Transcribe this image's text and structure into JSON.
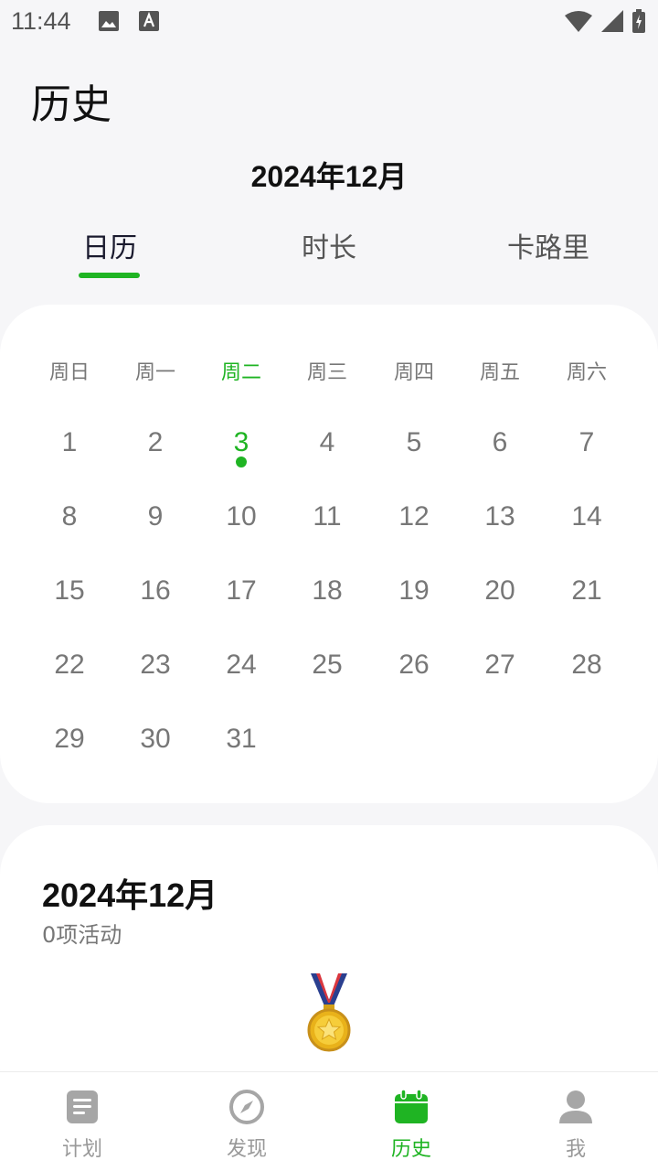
{
  "status_bar": {
    "time": "11:44"
  },
  "header": {
    "title": "历史",
    "month": "2024年12月"
  },
  "tabs": [
    {
      "label": "日历",
      "active": true
    },
    {
      "label": "时长",
      "active": false
    },
    {
      "label": "卡路里",
      "active": false
    }
  ],
  "calendar": {
    "weekdays": [
      "周日",
      "周一",
      "周二",
      "周三",
      "周四",
      "周五",
      "周六"
    ],
    "today_weekday_index": 2,
    "days": [
      [
        "1",
        "2",
        "3",
        "4",
        "5",
        "6",
        "7"
      ],
      [
        "8",
        "9",
        "10",
        "11",
        "12",
        "13",
        "14"
      ],
      [
        "15",
        "16",
        "17",
        "18",
        "19",
        "20",
        "21"
      ],
      [
        "22",
        "23",
        "24",
        "25",
        "26",
        "27",
        "28"
      ],
      [
        "29",
        "30",
        "31"
      ]
    ],
    "today": "3"
  },
  "summary": {
    "month": "2024年12月",
    "count": "0项活动"
  },
  "bottom_nav": [
    {
      "label": "计划",
      "icon": "plan-icon",
      "active": false
    },
    {
      "label": "发现",
      "icon": "compass-icon",
      "active": false
    },
    {
      "label": "历史",
      "icon": "calendar-icon",
      "active": true
    },
    {
      "label": "我",
      "icon": "person-icon",
      "active": false
    }
  ],
  "colors": {
    "accent": "#1fb423",
    "background": "#f6f6f8",
    "card": "#ffffff"
  }
}
